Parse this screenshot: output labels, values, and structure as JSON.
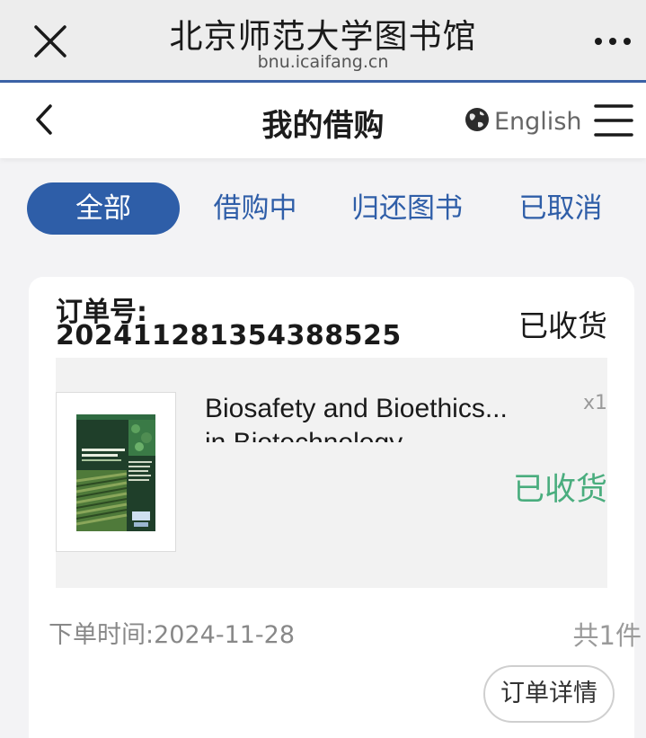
{
  "browser": {
    "title": "北京师范大学图书馆",
    "url": "bnu.icaifang.cn",
    "close_icon": "close-icon",
    "more_icon": "more-horizontal-icon"
  },
  "header": {
    "title": "我的借购",
    "language": "English",
    "back_icon": "chevron-left-icon",
    "globe_icon": "globe-icon",
    "menu_icon": "hamburger-menu-icon"
  },
  "tabs": [
    {
      "label": "全部",
      "active": true
    },
    {
      "label": "借购中",
      "active": false
    },
    {
      "label": "归还图书",
      "active": false
    },
    {
      "label": "已取消",
      "active": false
    }
  ],
  "order": {
    "number_label": "订单号:",
    "number": "20241128135438852​5",
    "status": "已收货",
    "item": {
      "title_line1": "Biosafety and Bioethics...",
      "title_line2": "in Biotechnology",
      "quantity": "x1",
      "status": "已收货",
      "cover_title": "Biosafety and Bioethics in Biotechnology"
    },
    "time_label": "下单时间:",
    "time": "2024-11-28",
    "count": "共1件",
    "detail_button": "订单详情"
  },
  "colors": {
    "accent": "#2e5ea8",
    "status_green": "#4aad7e",
    "rule_blue": "#3c63a7"
  }
}
